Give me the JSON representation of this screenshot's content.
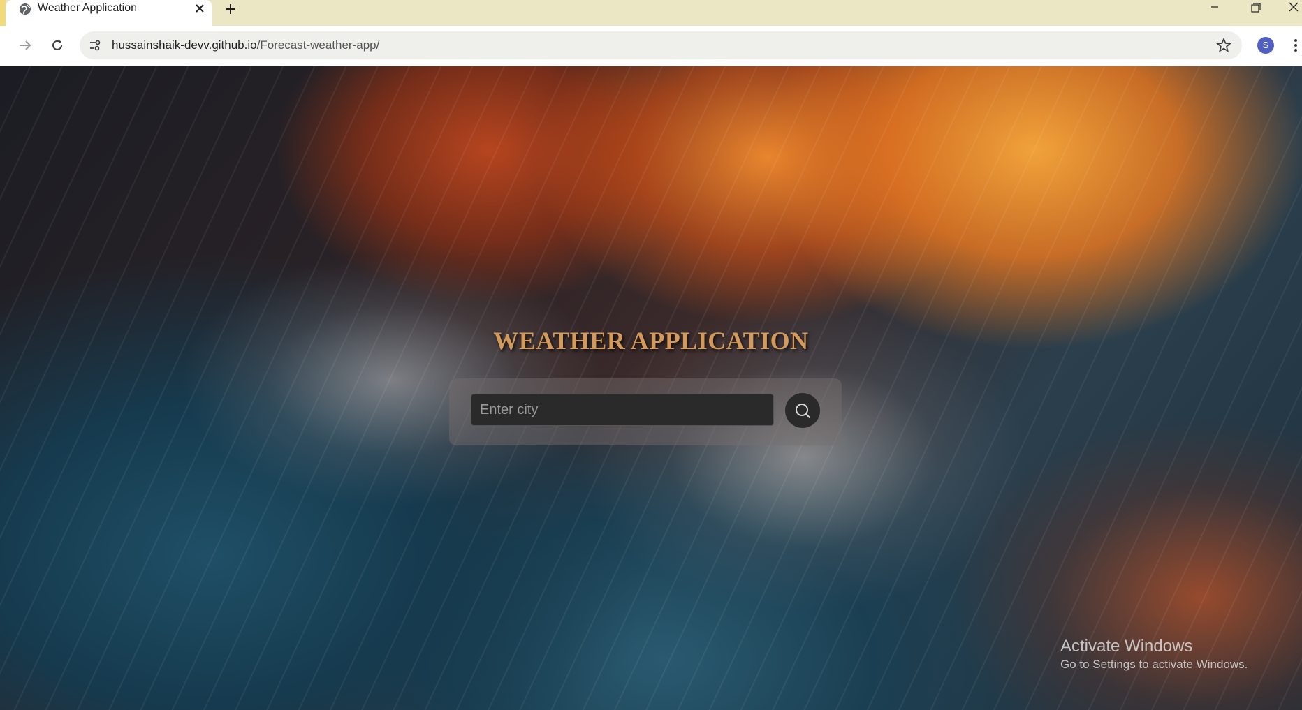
{
  "browser": {
    "tab_title": "Weather Application",
    "url_host": "hussainshaik-devv.github.io",
    "url_path": "/Forecast-weather-app/",
    "profile_initial": "S"
  },
  "page": {
    "title": "WEATHER APPLICATION",
    "search": {
      "placeholder": "Enter city",
      "value": ""
    }
  },
  "os_watermark": {
    "line1": "Activate Windows",
    "line2": "Go to Settings to activate Windows."
  },
  "colors": {
    "title": "#d39a5c",
    "input_bg": "#2a2a2a",
    "tabbar_bg": "#ebe6c4"
  }
}
